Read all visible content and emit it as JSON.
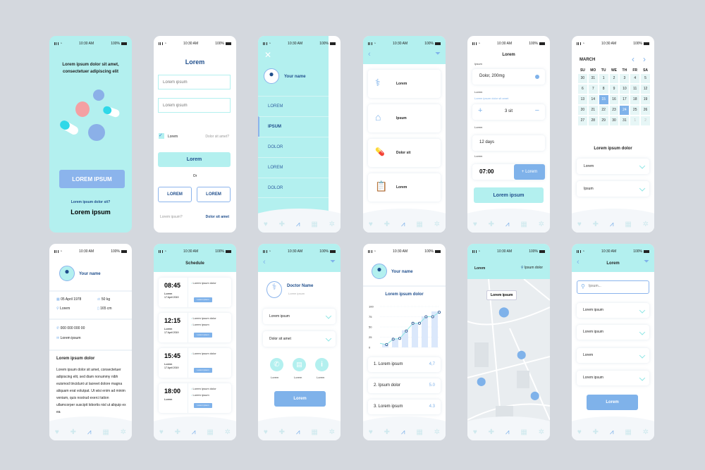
{
  "status": {
    "time": "10:30 AM",
    "battery": "100%"
  },
  "s1": {
    "headline": "Lorem ipsum dolor sit amet, consectetuer adipiscing elit",
    "cta": "LOREM IPSUM",
    "question": "Lorem ipsum dolor sit?",
    "link": "Lorem ipsum"
  },
  "s2": {
    "title": "Lorem",
    "field1_placeholder": "Lorem ipsum",
    "field2_placeholder": "Lorem ipsum",
    "checkbox_label": "Lorem",
    "forgot": "Dolor sit amet?",
    "submit": "Lorem",
    "or": "Or",
    "alt1": "LOREM",
    "alt2": "LOREM",
    "footer_left": "Lorem ipsum?",
    "footer_right": "Dolor sit amet"
  },
  "s3": {
    "user": "Your name",
    "menu": [
      "LOREM",
      "IPSUM",
      "DOLOR",
      "LOREM",
      "DOLOR"
    ],
    "active_index": 1
  },
  "s4": {
    "items": [
      {
        "icon": "doctor-icon",
        "label": "Lorem"
      },
      {
        "icon": "hospital-icon",
        "label": "Ipsum"
      },
      {
        "icon": "pills-icon",
        "label": "Dolor sit"
      },
      {
        "icon": "clipboard-icon",
        "label": "Lorem"
      }
    ]
  },
  "s5": {
    "title": "Lorem",
    "l1": "Ipsum",
    "med": "Dolor, 200mg",
    "l2": "Lorem",
    "hint": "Lorem ipsum dolor sit amet",
    "qty": "3 sit",
    "plus": "+",
    "minus": "−",
    "l3": "Lorem",
    "days": "12 days",
    "l4": "Lorem",
    "time": "07:00",
    "add": "+ Lorem",
    "submit": "Lorem ipsum"
  },
  "s6": {
    "month": "MARCH",
    "days": [
      "SU",
      "MO",
      "TU",
      "WE",
      "TH",
      "FR",
      "SA"
    ],
    "dates": [
      "30",
      "31",
      "1",
      "2",
      "3",
      "4",
      "5",
      "6",
      "7",
      "8",
      "9",
      "10",
      "11",
      "12",
      "13",
      "14",
      "15",
      "16",
      "17",
      "18",
      "19",
      "20",
      "21",
      "22",
      "23",
      "24",
      "25",
      "26",
      "27",
      "28",
      "29",
      "30",
      "31",
      "1",
      "2"
    ],
    "selected": [
      "15",
      "24"
    ],
    "subtitle": "Lorem ipsum dolor",
    "dd1": "Lorem",
    "dd2": "Ipsum"
  },
  "s7": {
    "user": "Your name",
    "dob": "05 April 1978",
    "weight": "50 kg",
    "location": "Lorem",
    "height": "165 cm",
    "phone": "000 000 000 00",
    "email": "Lorem ipsum",
    "about_title": "Lorem ipsum dolor",
    "about": "Lorem ipsum dolor sit amet, consectetuer adipiscing elit, sed diam nonummy nibh euismod tincidunt ut laoreet dolore magna aliquam erat volutpat. Ut wisi enim ad minim veniam, quis nostrud exerci tation ullamcorper suscipit lobortis nisl ut aliquip ex ea"
  },
  "s8": {
    "title": "Schedule",
    "rows": [
      {
        "time": "08:45",
        "label": "Lorem",
        "date": "17 April 2019",
        "items": [
          "Lorem ipsum dolor"
        ],
        "tag": "Lorem ipsum"
      },
      {
        "time": "12:15",
        "label": "Lorem",
        "date": "17 April 2019",
        "items": [
          "Lorem ipsum dolor",
          "Lorem ipsum"
        ],
        "tag": "Lorem ipsum"
      },
      {
        "time": "15:45",
        "label": "Lorem",
        "date": "17 April 2019",
        "items": [
          "Lorem ipsum dolor"
        ],
        "tag": "Lorem ipsum"
      },
      {
        "time": "18:00",
        "label": "Lorem",
        "date": "",
        "items": [
          "Lorem ipsum dolor",
          "Lorem ipsum"
        ],
        "tag": "Lorem ipsum"
      }
    ]
  },
  "s9": {
    "doctor": "Doctor Name",
    "subtitle": "Lorem ipsum",
    "dd1": "Lorem ipsum",
    "dd2": "Dolor sit amet",
    "actions": [
      "Lorem",
      "Lorem",
      "Lorem"
    ],
    "submit": "Lorem"
  },
  "s10": {
    "user": "Your name",
    "chart_title": "Lorem ipsum dolor",
    "ratings": [
      {
        "label": "1. Lorem ipsum",
        "value": "4,7"
      },
      {
        "label": "2. Ipsum dolor",
        "value": "5.0"
      },
      {
        "label": "3. Lorem ipsum",
        "value": "4.3"
      }
    ]
  },
  "s11": {
    "title": "Lorem",
    "location": "Ipsum dolor",
    "tooltip": "Lorem ipsum"
  },
  "s12": {
    "title": "Lorem",
    "search_placeholder": "Ipsum...",
    "items": [
      "Lorem ipsum",
      "Lorem ipsum",
      "Lorem",
      "Lorem ipsum"
    ],
    "submit": "Lorem"
  },
  "chart_data": {
    "type": "bar",
    "title": "Lorem ipsum dolor",
    "yticks": [
      "0",
      "25",
      "50",
      "75",
      "100"
    ],
    "ylim": [
      0,
      100
    ],
    "bars": [
      8,
      22,
      42,
      60,
      76,
      88
    ],
    "line": [
      10,
      7,
      20,
      22,
      40,
      59,
      59,
      75,
      75,
      86
    ]
  },
  "colors": {
    "teal": "#b3f0ef",
    "blue": "#7fb2ea",
    "navy": "#1f4e8c"
  }
}
